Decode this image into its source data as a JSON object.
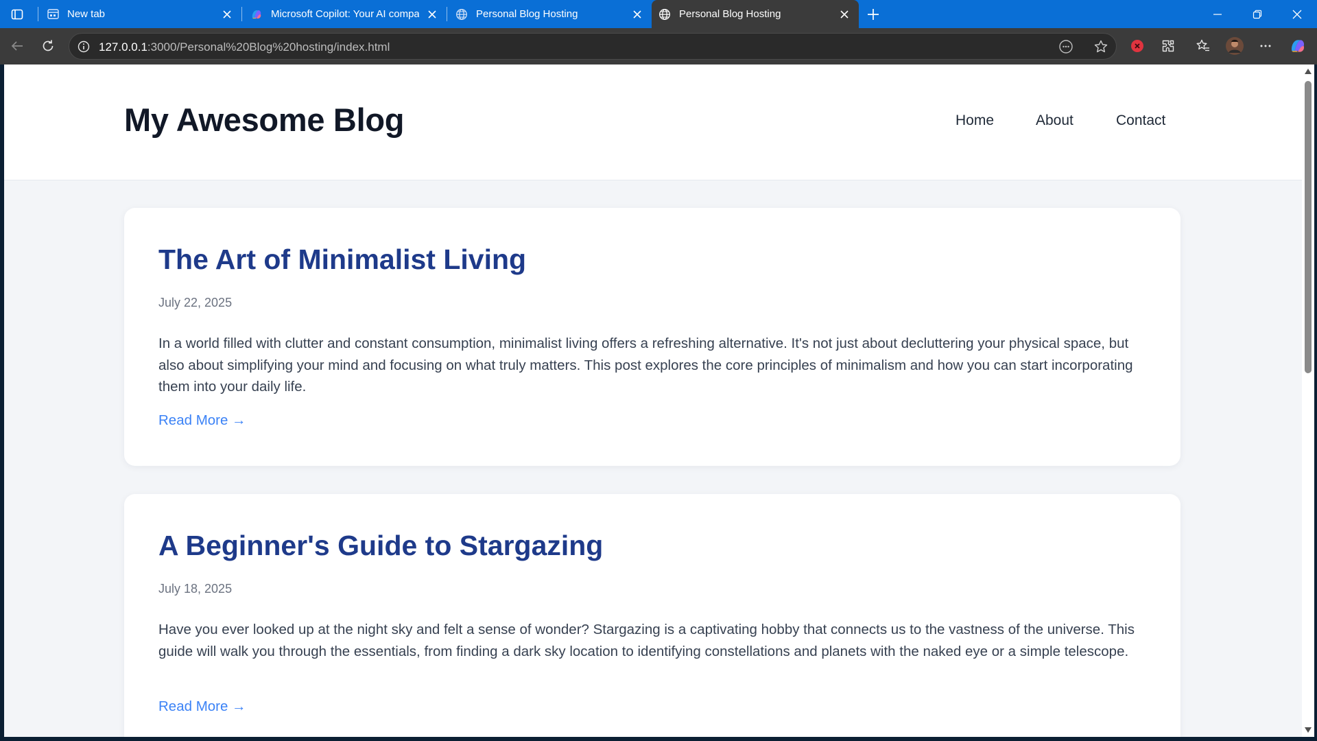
{
  "browser": {
    "tabs": [
      {
        "title": "New tab",
        "favicon": "new-tab-page-icon"
      },
      {
        "title": "Microsoft Copilot: Your AI compa",
        "favicon": "copilot-icon"
      },
      {
        "title": "Personal Blog Hosting",
        "favicon": "globe-icon"
      },
      {
        "title": "Personal Blog Hosting",
        "favicon": "globe-icon",
        "active": true
      }
    ],
    "address": {
      "host": "127.0.0.1",
      "path": ":3000/Personal%20Blog%20hosting/index.html"
    },
    "colors": {
      "tabstrip": "#0a6fd6",
      "toolbar": "#3b3b3b",
      "omnibox": "#2a2a2a"
    }
  },
  "site": {
    "title": "My Awesome Blog",
    "nav": [
      {
        "label": "Home"
      },
      {
        "label": "About"
      },
      {
        "label": "Contact"
      }
    ]
  },
  "posts": [
    {
      "title": "The Art of Minimalist Living",
      "date": "July 22, 2025",
      "excerpt": "In a world filled with clutter and constant consumption, minimalist living offers a refreshing alternative. It's not just about decluttering your physical space, but also about simplifying your mind and focusing on what truly matters. This post explores the core principles of minimalism and how you can start incorporating them into your daily life.",
      "read_more": "Read More →"
    },
    {
      "title": "A Beginner's Guide to Stargazing",
      "date": "July 18, 2025",
      "excerpt": "Have you ever looked up at the night sky and felt a sense of wonder? Stargazing is a captivating hobby that connects us to the vastness of the universe. This guide will walk you through the essentials, from finding a dark sky location to identifying constellations and planets with the naked eye or a simple telescope.",
      "read_more": "Read More →"
    }
  ],
  "theme": {
    "title_color": "#1e3a8a",
    "link_color": "#3b82f6",
    "page_background": "#f3f5f8"
  }
}
